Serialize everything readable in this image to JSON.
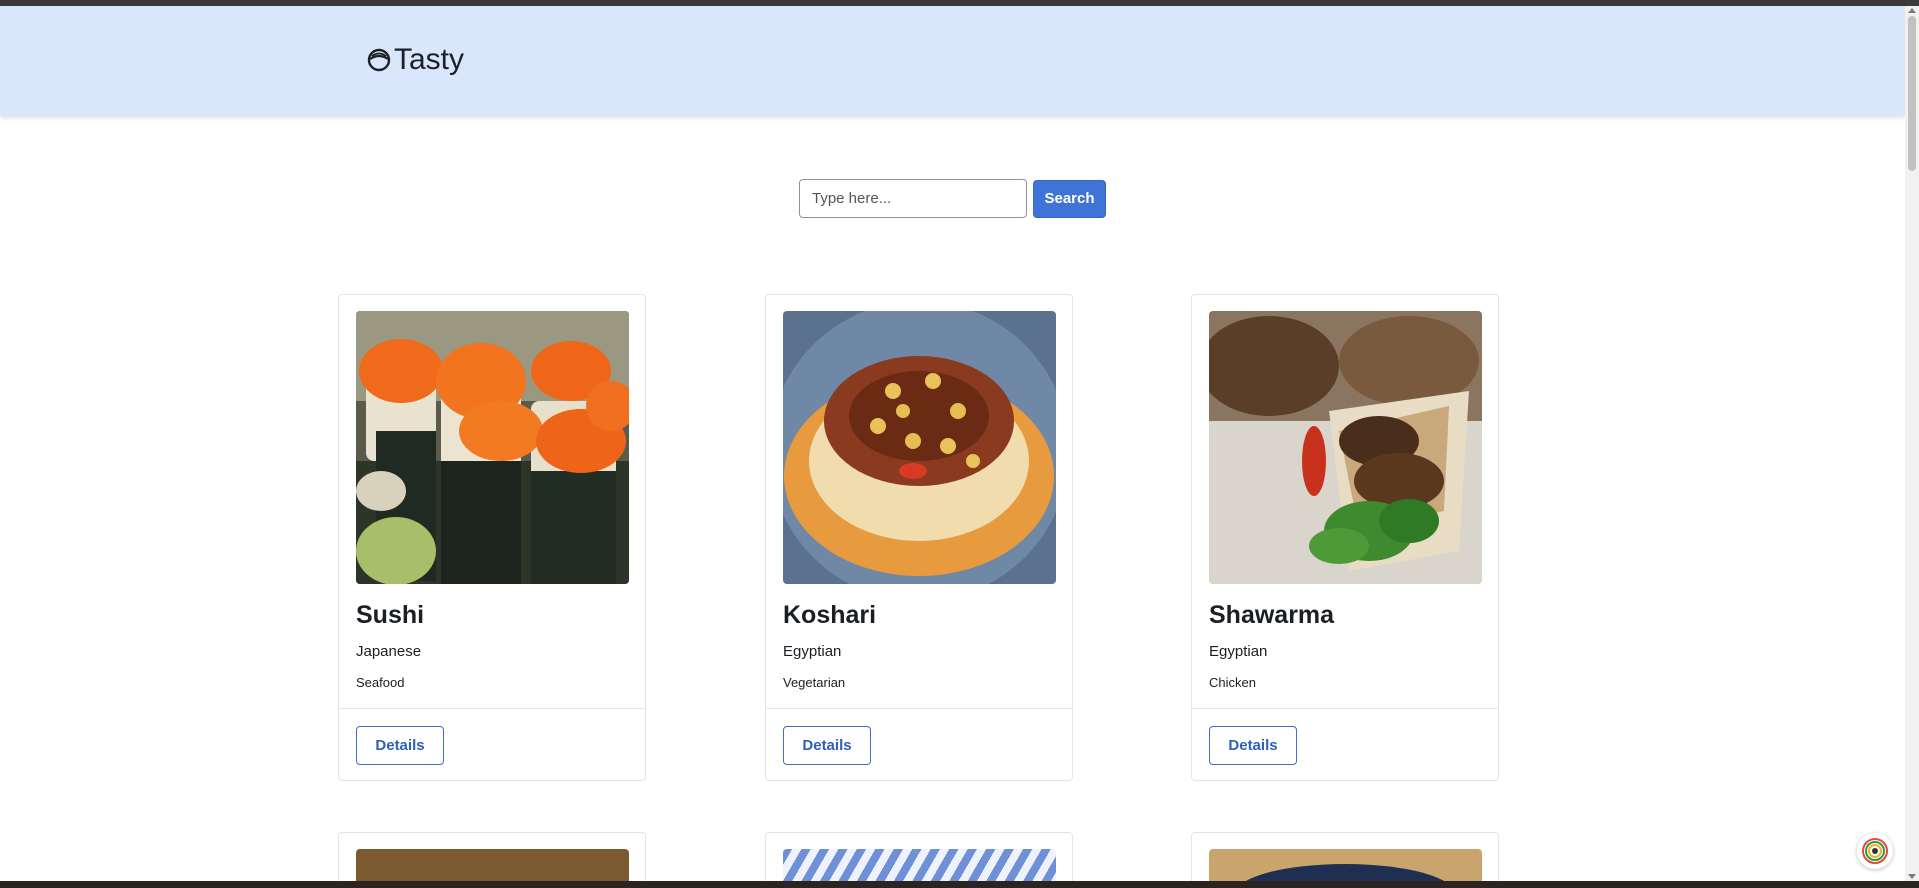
{
  "app": {
    "brand_name": "Tasty",
    "brand_icon": "bowl-icon",
    "accent_color": "#3f74d6",
    "navbar_color": "#dae6fc"
  },
  "search": {
    "placeholder": "Type here...",
    "value": "",
    "button_label": "Search"
  },
  "recipes": [
    {
      "title": "Sushi",
      "cuisine": "Japanese",
      "category": "Seafood",
      "action_label": "Details"
    },
    {
      "title": "Koshari",
      "cuisine": "Egyptian",
      "category": "Vegetarian",
      "action_label": "Details"
    },
    {
      "title": "Shawarma",
      "cuisine": "Egyptian",
      "category": "Chicken",
      "action_label": "Details"
    }
  ]
}
